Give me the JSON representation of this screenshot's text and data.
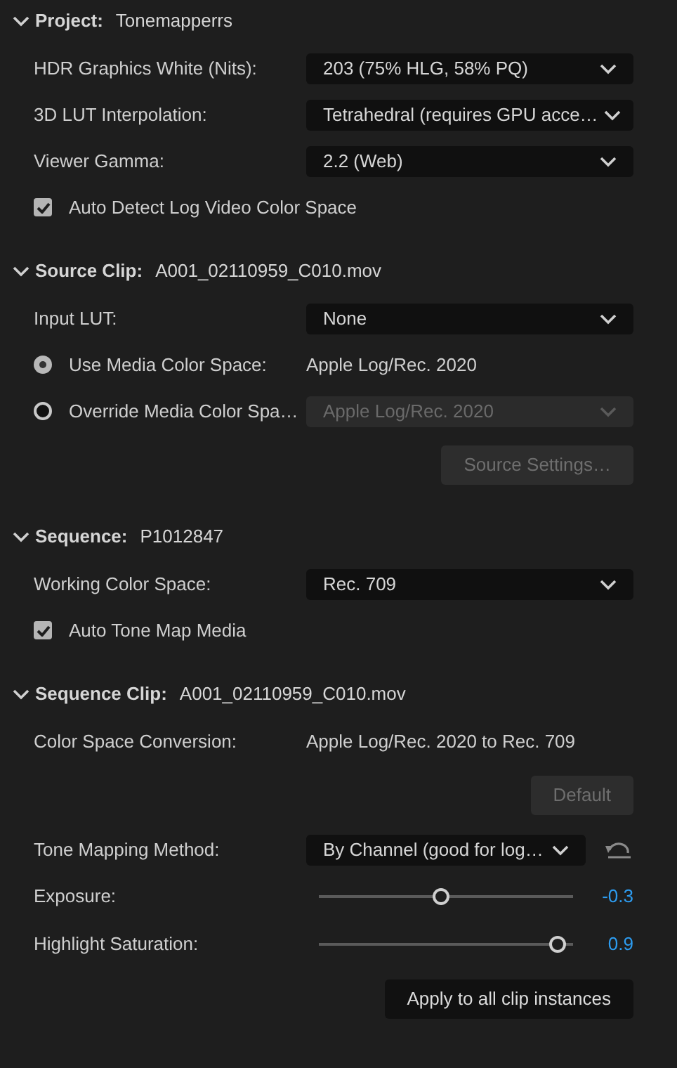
{
  "sections": [
    {
      "label": "Project:",
      "value": "Tonemapperrs",
      "expanded": true,
      "rows": [
        {
          "kind": "dropdown",
          "label": "HDR Graphics White (Nits):",
          "value": "203 (75% HLG, 58% PQ)",
          "disabled": false
        },
        {
          "kind": "dropdown",
          "label": "3D LUT Interpolation:",
          "value": "Tetrahedral (requires GPU acce…",
          "disabled": false
        },
        {
          "kind": "dropdown",
          "label": "Viewer Gamma:",
          "value": "2.2 (Web)",
          "disabled": false
        },
        {
          "kind": "checkbox",
          "label": "Auto Detect Log Video Color Space",
          "checked": true
        }
      ]
    },
    {
      "label": "Source Clip:",
      "value": "A001_02110959_C010.mov",
      "expanded": true,
      "rows": [
        {
          "kind": "dropdown",
          "label": "Input LUT:",
          "value": "None",
          "disabled": false
        },
        {
          "kind": "radio_text",
          "label": "Use Media Color Space:",
          "value": "Apple Log/Rec. 2020",
          "selected": true
        },
        {
          "kind": "radio_dropdown",
          "label": "Override Media Color Spa…",
          "value": "Apple Log/Rec. 2020",
          "selected": false,
          "disabled": true
        },
        {
          "kind": "button",
          "label": "Source Settings…",
          "disabled": true
        }
      ]
    },
    {
      "label": "Sequence:",
      "value": "P1012847",
      "expanded": true,
      "rows": [
        {
          "kind": "dropdown",
          "label": "Working Color Space:",
          "value": "Rec. 709",
          "disabled": false
        },
        {
          "kind": "checkbox",
          "label": "Auto Tone Map Media",
          "checked": true
        }
      ]
    },
    {
      "label": "Sequence Clip:",
      "value": "A001_02110959_C010.mov",
      "expanded": true,
      "rows": [
        {
          "kind": "text",
          "label": "Color Space Conversion:",
          "value": "Apple Log/Rec. 2020 to Rec. 709"
        },
        {
          "kind": "button",
          "label": "Default",
          "disabled": true
        },
        {
          "kind": "dropdown_reset",
          "label": "Tone Mapping Method:",
          "value": "By Channel (good for log…",
          "disabled": false
        },
        {
          "kind": "slider",
          "label": "Exposure:",
          "level": 0.48,
          "reading": "-0.3"
        },
        {
          "kind": "slider",
          "label": "Highlight Saturation:",
          "level": 0.94,
          "reading": "0.9"
        },
        {
          "kind": "button",
          "label": "Apply to all clip instances",
          "disabled": false
        }
      ]
    }
  ]
}
